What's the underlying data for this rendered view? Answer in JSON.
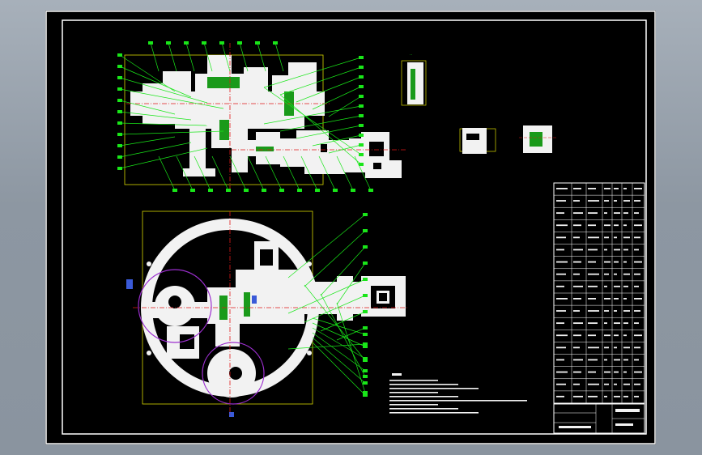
{
  "colors": {
    "background": "#8e98a3",
    "paper": "#000000",
    "frame": "#ffffff",
    "part_fill": "#f2f2f2",
    "leader": "#19e619",
    "hatch": "#1a9a1a",
    "bbox": "#d8d800",
    "center_line": "#e01818",
    "gear_pitch": "#9c2fcf",
    "accent_blue": "#3a5ad8"
  },
  "views": {
    "main_section": {
      "balloon_count_left": 11,
      "balloon_count_right": 12,
      "balloon_count_top": 8,
      "balloon_count_bottom": 12
    },
    "plan_view": {
      "balloon_count_right": 12
    }
  },
  "icons": [
    "gearbox-section-view",
    "plan-view",
    "detail-view-a",
    "detail-view-b",
    "detail-view-c",
    "parts-list",
    "title-block",
    "technical-notes"
  ],
  "title_block": {
    "rows": 18
  }
}
